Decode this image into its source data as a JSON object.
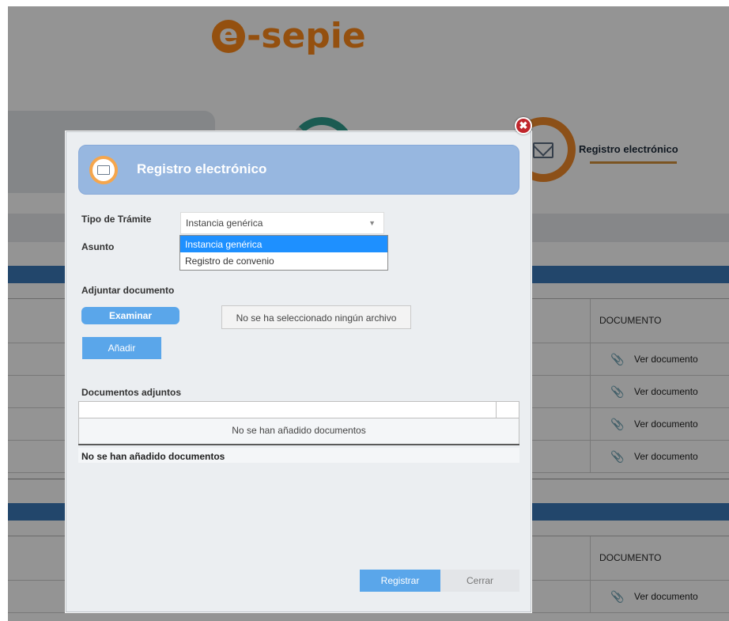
{
  "app": {
    "logo_text": "e-sepie"
  },
  "background": {
    "active_tab_label": "Registro electrónico",
    "table1": {
      "column_header": "DOCUMENTO",
      "rows": [
        "Ver documento",
        "Ver documento",
        "Ver documento",
        "Ver documento"
      ]
    },
    "table2": {
      "column_header": "DOCUMENTO",
      "rows": [
        "Ver documento"
      ]
    }
  },
  "modal": {
    "title": "Registro electrónico",
    "tipo_label": "Tipo de Trámite",
    "tipo_value": "Instancia genérica",
    "tipo_options": [
      "Instancia genérica",
      "Registro de convenio"
    ],
    "tipo_selected_index": 0,
    "asunto_label": "Asunto",
    "adjuntar_label": "Adjuntar documento",
    "examinar_label": "Examinar",
    "file_status": "No se ha seleccionado ningún archivo",
    "anadir_label": "Añadir",
    "documentos_label": "Documentos adjuntos",
    "documentos_empty": "No se han añadido documentos",
    "documentos_footer": "No se han añadido documentos",
    "registrar_label": "Registrar",
    "cerrar_label": "Cerrar"
  },
  "colors": {
    "brand_orange": "#ff8a1a",
    "header_blue": "#97b7e0",
    "button_blue": "#5aa6ea",
    "bar_blue": "#3b79b8",
    "close_red": "#c0262c"
  }
}
